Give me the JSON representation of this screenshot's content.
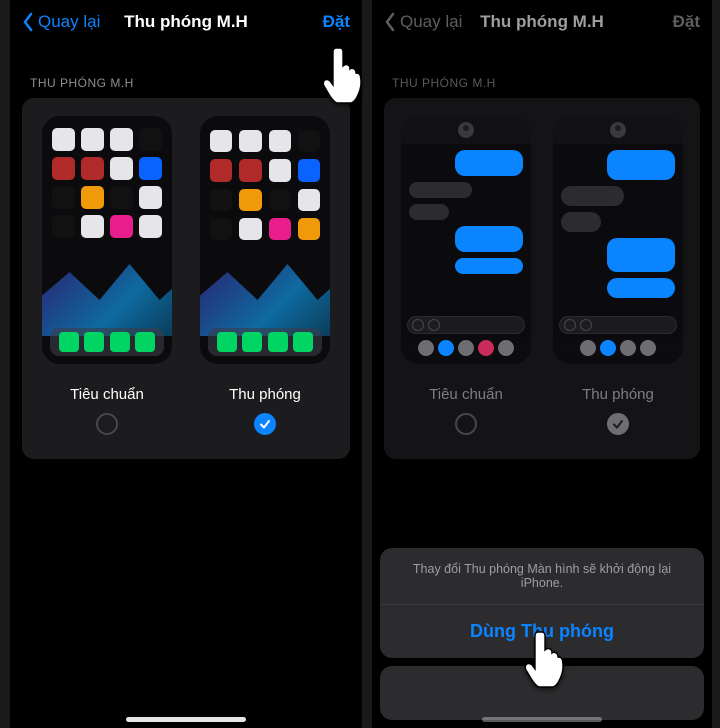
{
  "nav": {
    "back_label": "Quay lại",
    "title": "Thu phóng M.H",
    "set_label": "Đặt"
  },
  "section": {
    "header": "THU PHÓNG M.H"
  },
  "options": {
    "standard": "Tiêu chuẩn",
    "zoomed": "Thu phóng"
  },
  "sheet": {
    "message": "Thay đổi Thu phóng Màn hình sẽ khởi động lại iPhone.",
    "confirm": "Dùng Thu phóng"
  },
  "appbar_colors": [
    "#6e6e72",
    "#0a84ff",
    "#6e6e72",
    "#c92b5a",
    "#6e6e72"
  ]
}
